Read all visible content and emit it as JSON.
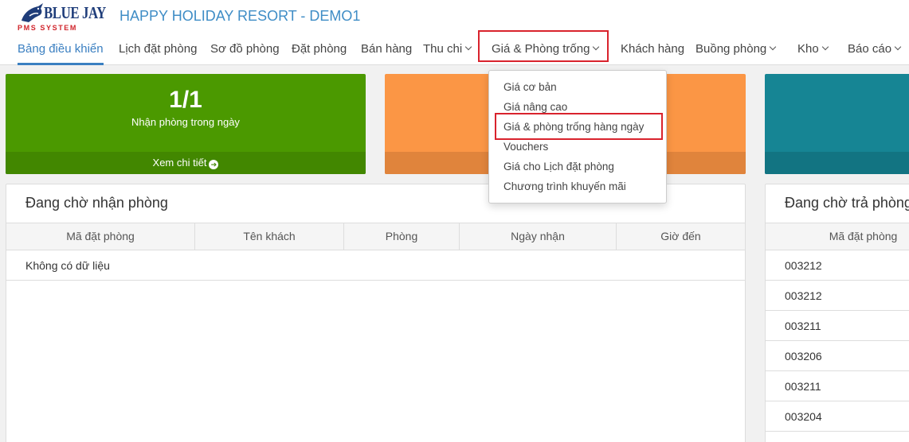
{
  "logo": {
    "main": "BLUE JAY",
    "sub": "PMS SYSTEM"
  },
  "hotel_title": "HAPPY HOLIDAY RESORT - DEMO1",
  "nav": {
    "items": [
      {
        "label": "Bảng điều khiển"
      },
      {
        "label": "Lịch đặt phòng"
      },
      {
        "label": "Sơ đồ phòng"
      },
      {
        "label": "Đặt phòng"
      },
      {
        "label": "Bán hàng"
      },
      {
        "label": "Thu chi"
      },
      {
        "label": "Giá & Phòng trống"
      },
      {
        "label": "Khách hàng"
      },
      {
        "label": "Buồng phòng"
      },
      {
        "label": "Kho"
      },
      {
        "label": "Báo cáo"
      }
    ]
  },
  "dropdown": {
    "items": [
      {
        "label": "Giá cơ bản"
      },
      {
        "label": "Giá nâng cao"
      },
      {
        "label": "Giá & phòng trống hàng ngày"
      },
      {
        "label": "Vouchers"
      },
      {
        "label": "Giá cho Lịch đặt phòng"
      },
      {
        "label": "Chương trình khuyến mãi"
      }
    ]
  },
  "tiles": {
    "green": {
      "number": "1/1",
      "label": "Nhận phòng trong ngày",
      "footer": "Xem chi tiết"
    }
  },
  "left_panel": {
    "title": "Đang chờ nhận phòng",
    "columns": [
      "Mã đặt phòng",
      "Tên khách",
      "Phòng",
      "Ngày nhận",
      "Giờ đến"
    ],
    "empty_text": "Không có dữ liệu"
  },
  "right_panel": {
    "title": "Đang chờ trả phòng",
    "column": "Mã đặt phòng",
    "rows": [
      "003212",
      "003212",
      "003211",
      "003206",
      "003211",
      "003204"
    ]
  },
  "colors": {
    "accent": "#3a7fc1",
    "highlight": "#d9232d",
    "tile_green": "#4b9900",
    "tile_orange": "#fb9645",
    "tile_teal": "#168594"
  },
  "icons": {
    "logo": "blue-jay-bird-icon",
    "footer_arrow": "arrow-circle-right-icon",
    "dropdown_caret": "chevron-down-icon"
  }
}
